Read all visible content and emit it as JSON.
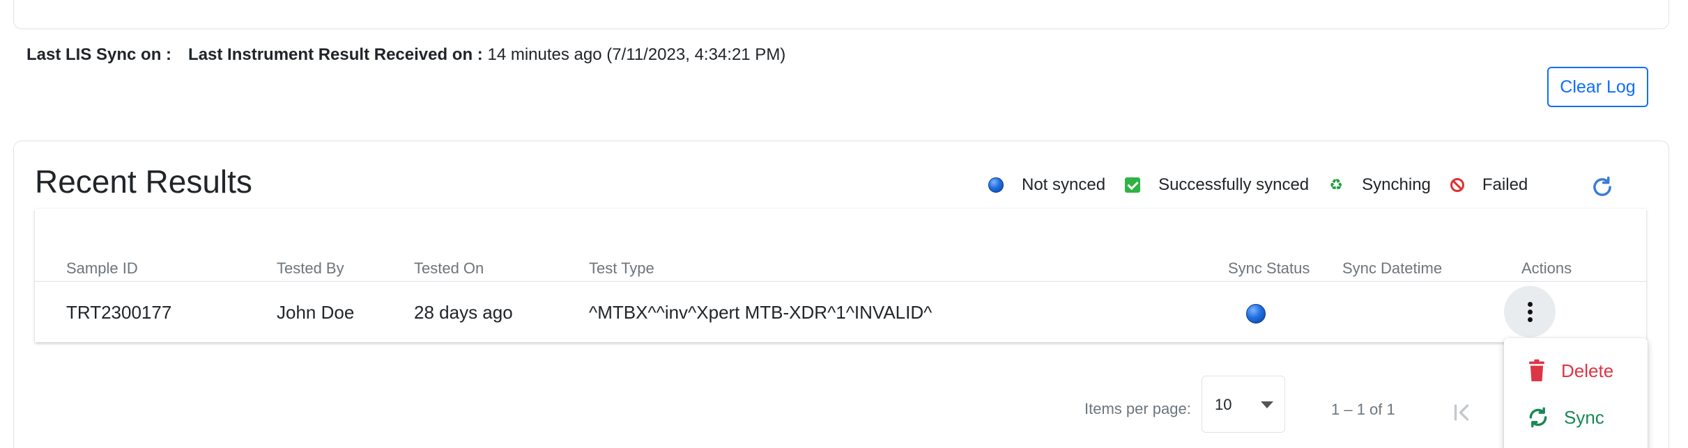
{
  "sync_info": {
    "lis_label": "Last LIS Sync on :",
    "instrument_label": "Last Instrument Result Received on :",
    "instrument_value": "14 minutes ago (7/11/2023, 4:34:21 PM)"
  },
  "toolbar": {
    "clear_log_label": "Clear Log"
  },
  "results": {
    "title": "Recent Results",
    "legend": [
      {
        "icon": "blue-dot-icon",
        "label": "Not synced"
      },
      {
        "icon": "green-check-icon",
        "label": "Successfully synced"
      },
      {
        "icon": "recycle-icon",
        "label": "Synching"
      },
      {
        "icon": "no-entry-icon",
        "label": "Failed"
      }
    ],
    "refresh_icon": "refresh-icon"
  },
  "table": {
    "columns": [
      "Sample ID",
      "Tested By",
      "Tested On",
      "Test Type",
      "Sync Status",
      "Sync Datetime",
      "Actions"
    ],
    "rows": [
      {
        "sample_id": "TRT2300177",
        "tested_by": "John Doe",
        "tested_on": "28 days ago",
        "test_type": "^MTBX^^inv^Xpert MTB-XDR^1^INVALID^",
        "sync_status": "Not synced",
        "sync_datetime": ""
      }
    ]
  },
  "actions_menu": {
    "delete_label": "Delete",
    "sync_label": "Sync"
  },
  "paginator": {
    "items_per_page_label": "Items per page:",
    "items_per_page_value": "10",
    "range_label": "1 – 1 of 1"
  },
  "colors": {
    "primary": "#0d6efd",
    "danger": "#dc3545",
    "success": "#198754",
    "muted": "#6c757d",
    "not_synced_dot": "#1f6fe0"
  }
}
